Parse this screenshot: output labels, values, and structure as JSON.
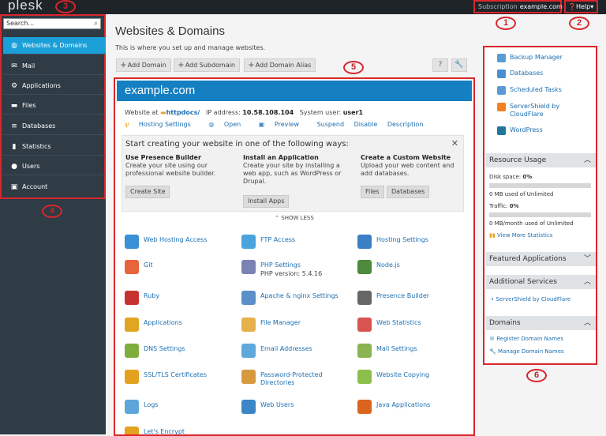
{
  "topbar": {
    "logo": "plesk",
    "subscription_label": "Subscription",
    "subscription_value": "example.com",
    "help_label": "Help"
  },
  "markers": [
    "1",
    "2",
    "3",
    "4",
    "5",
    "6"
  ],
  "sidebar": {
    "search_placeholder": "Search...",
    "items": [
      {
        "label": "Websites & Domains",
        "icon": "globe-icon"
      },
      {
        "label": "Mail",
        "icon": "envelope-icon"
      },
      {
        "label": "Applications",
        "icon": "gear-icon"
      },
      {
        "label": "Files",
        "icon": "folder-icon"
      },
      {
        "label": "Databases",
        "icon": "database-icon"
      },
      {
        "label": "Statistics",
        "icon": "bar-chart-icon"
      },
      {
        "label": "Users",
        "icon": "user-icon"
      },
      {
        "label": "Account",
        "icon": "account-icon"
      }
    ]
  },
  "main": {
    "title": "Websites & Domains",
    "subtitle": "This is where you set up and manage websites.",
    "toolbar": [
      "Add Domain",
      "Add Subdomain",
      "Add Domain Alias"
    ],
    "help_glyph": "?",
    "wrench_glyph": "🔧"
  },
  "domain": {
    "name": "example.com",
    "website_at_label": "Website at",
    "website_at_value": "httpdocs/",
    "ip_label": "IP address:",
    "ip_value": "10.58.108.104",
    "user_label": "System user:",
    "user_value": "user1",
    "links": [
      "Hosting Settings",
      "Open",
      "Preview",
      "Suspend",
      "Disable",
      "Description"
    ]
  },
  "start": {
    "title": "Start creating your website in one of the following ways:",
    "close": "✕",
    "columns": [
      {
        "heading": "Use Presence Builder",
        "desc": "Create your site using our professional website builder.",
        "buttons": [
          "Create Site"
        ]
      },
      {
        "heading": "Install an Application",
        "desc": "Create your site by installing a web app, such as WordPress or Drupal.",
        "buttons": [
          "Install Apps"
        ]
      },
      {
        "heading": "Create a Custom Website",
        "desc": "Upload your web content and add databases.",
        "buttons": [
          "Files",
          "Databases"
        ]
      }
    ],
    "show_less": "⌃ SHOW LESS"
  },
  "tools": [
    {
      "label": "Web Hosting Access",
      "icon": "web-hosting-icon",
      "color": "#3b8fd6"
    },
    {
      "label": "FTP Access",
      "icon": "ftp-icon",
      "color": "#4aa3df"
    },
    {
      "label": "Hosting Settings",
      "icon": "hosting-settings-icon",
      "color": "#3b7fc4"
    },
    {
      "label": "Git",
      "icon": "git-icon",
      "color": "#e8643c"
    },
    {
      "label": "PHP Settings",
      "sub": "PHP version: 5.4.16",
      "icon": "php-icon",
      "color": "#7b83b5"
    },
    {
      "label": "Node.js",
      "icon": "nodejs-icon",
      "color": "#4e8a3c"
    },
    {
      "label": "Ruby",
      "icon": "ruby-icon",
      "color": "#c8322e"
    },
    {
      "label": "Apache & nginx Settings",
      "icon": "apache-icon",
      "color": "#5b8fc7"
    },
    {
      "label": "Presence Builder",
      "icon": "presence-builder-icon",
      "color": "#666666"
    },
    {
      "label": "Applications",
      "icon": "applications-icon",
      "color": "#e2a521"
    },
    {
      "label": "File Manager",
      "icon": "file-manager-icon",
      "color": "#e6b04a"
    },
    {
      "label": "Web Statistics",
      "icon": "web-statistics-icon",
      "color": "#d9534f"
    },
    {
      "label": "DNS Settings",
      "icon": "dns-icon",
      "color": "#7fae3f"
    },
    {
      "label": "Email Addresses",
      "icon": "email-icon",
      "color": "#5fa8dc"
    },
    {
      "label": "Mail Settings",
      "icon": "mail-settings-icon",
      "color": "#8ab451"
    },
    {
      "label": "SSL/TLS Certificates",
      "icon": "ssl-icon",
      "color": "#e3a11e"
    },
    {
      "label": "Password-Protected Directories",
      "icon": "password-dir-icon",
      "color": "#d79a3e"
    },
    {
      "label": "Website Copying",
      "icon": "website-copying-icon",
      "color": "#8cbf4b"
    },
    {
      "label": "Logs",
      "icon": "logs-icon",
      "color": "#5ca6d9"
    },
    {
      "label": "Web Users",
      "icon": "web-users-icon",
      "color": "#3b86c6"
    },
    {
      "label": "Java Applications",
      "icon": "java-icon",
      "color": "#d9651f"
    },
    {
      "label": "Let's Encrypt",
      "icon": "lets-encrypt-icon",
      "color": "#e3a11e"
    }
  ],
  "right": {
    "quick_links": [
      {
        "label": "Backup Manager",
        "icon": "backup-icon",
        "color": "#5a9bd5"
      },
      {
        "label": "Databases",
        "icon": "database-icon",
        "color": "#4a90d0"
      },
      {
        "label": "Scheduled Tasks",
        "icon": "calendar-icon",
        "color": "#5b9ad6"
      },
      {
        "label": "ServerShield by CloudFlare",
        "icon": "cloudflare-icon",
        "color": "#f38020"
      },
      {
        "label": "WordPress",
        "icon": "wordpress-icon",
        "color": "#21759b"
      }
    ],
    "resource_usage": {
      "title": "Resource Usage",
      "disk_label": "Disk space:",
      "disk_pct": "0%",
      "disk_used": "0 MB used of Unlimited",
      "traffic_label": "Traffic:",
      "traffic_pct": "0%",
      "traffic_used": "0 MB/month used of Unlimited",
      "more_stats": "View More Statistics"
    },
    "featured": {
      "title": "Featured Applications"
    },
    "additional": {
      "title": "Additional Services",
      "items": [
        "ServerShield by CloudFlare"
      ]
    },
    "domains": {
      "title": "Domains",
      "items": [
        "Register Domain Names",
        "Manage Domain Names"
      ]
    }
  }
}
